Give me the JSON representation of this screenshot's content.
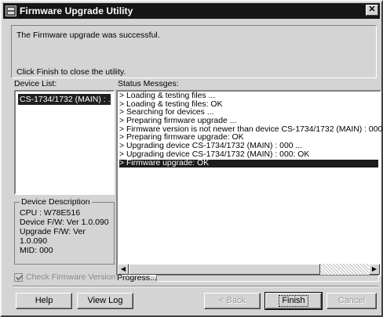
{
  "window": {
    "title": "Firmware Upgrade Utility",
    "close_label": "✕"
  },
  "message": {
    "line1": "The Firmware upgrade was successful.",
    "line2": "Click Finish to close the utility."
  },
  "device_list": {
    "label": "Device List:",
    "items": [
      "CS-1734/1732 (MAIN) : ..."
    ]
  },
  "device_description": {
    "title": "Device Description",
    "cpu": "CPU : W78E516",
    "device_fw": "Device F/W: Ver 1.0.090",
    "upgrade_fw": "Upgrade F/W: Ver 1.0.090",
    "mid": "MID: 000"
  },
  "status": {
    "label": "Status Messges:",
    "items": [
      "> Loading & testing files ...",
      "> Loading & testing files: OK",
      "> Searching for devices ...",
      "> Preparing firmware upgrade ...",
      "> Firmware version is not newer than device CS-1734/1732 (MAIN) : 000",
      "> Preparing firmware upgrade: OK",
      "> Upgrading device CS-1734/1732 (MAIN) : 000 ...",
      "> Upgrading device CS-1734/1732 (MAIN) : 000: OK",
      "> Firmware upgrade: OK"
    ],
    "selected_index": 8
  },
  "scrollbar": {
    "left_arrow": "◀",
    "right_arrow": "▶"
  },
  "check_firmware_label": "Check Firmware Version",
  "check_firmware_checked": true,
  "progress": {
    "label": "Progress...",
    "value": 0
  },
  "buttons": {
    "help": "Help",
    "view_log": "View Log",
    "back": "< Back",
    "finish": "Finish",
    "cancel": "Cancel"
  }
}
